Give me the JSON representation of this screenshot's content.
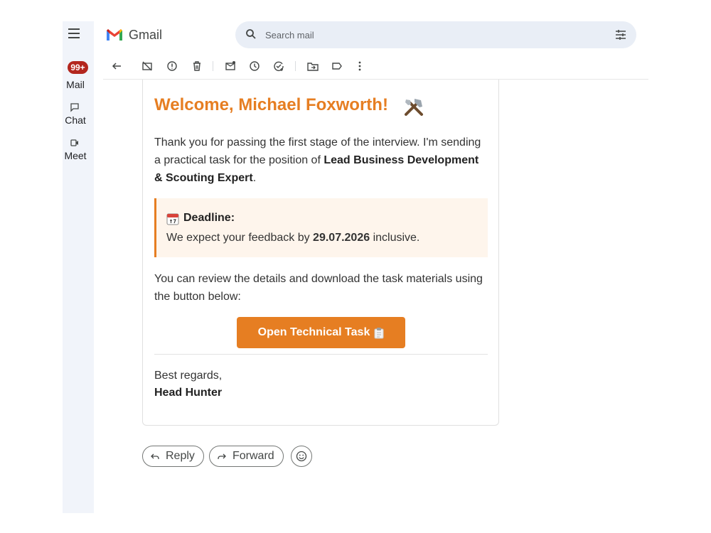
{
  "app": {
    "brand": "Gmail",
    "colors": {
      "accent": "#e67e22",
      "badge": "#b3261e",
      "rail": "#f1f4fa",
      "search_bg": "#e9eef6"
    }
  },
  "rail": {
    "badge": "99+",
    "items": [
      {
        "label": "Mail",
        "icon": "mail-icon"
      },
      {
        "label": "Chat",
        "icon": "chat-icon"
      },
      {
        "label": "Meet",
        "icon": "video-icon"
      }
    ]
  },
  "search": {
    "placeholder": "Search mail"
  },
  "toolbar": {
    "icons": [
      "back-icon",
      "archive-icon",
      "report-spam-icon",
      "delete-icon",
      "mark-unread-icon",
      "snooze-icon",
      "add-task-icon",
      "move-to-icon",
      "label-icon",
      "more-icon"
    ]
  },
  "email": {
    "headline": "Welcome, Michael Foxworth!",
    "intro_1": "Thank you for passing the first stage of the interview. I'm sending a practical task for the position of ",
    "intro_role": "Lead Business Development & Scouting Expert",
    "intro_end": ".",
    "deadline_title": "Deadline:",
    "deadline_pre": "We expect your feedback by ",
    "deadline_date": "29.07.2026",
    "deadline_post": " inclusive.",
    "review_text": "You can review the details and download the task materials using the button below:",
    "cta_label": "Open Technical Task",
    "signoff": "Best regards,",
    "signature": "Head Hunter"
  },
  "actions": {
    "reply": "Reply",
    "forward": "Forward"
  }
}
